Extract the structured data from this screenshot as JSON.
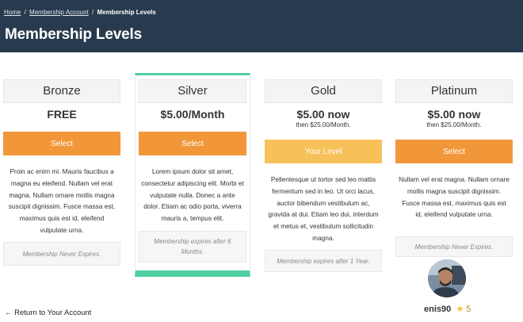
{
  "breadcrumb": {
    "home": "Home",
    "account": "Membership Account",
    "current": "Membership Levels",
    "separator": "/"
  },
  "page_title": "Membership Levels",
  "plans": [
    {
      "name": "Bronze",
      "price": "FREE",
      "price_sub": "",
      "button": "Select",
      "description": "Proin ac enim mi. Mauris faucibus a magna eu eleifend. Nullam vel erat magna. Nullam ornare mollis magna suscipit dignissim. Fusce massa est, maximus quis est id, eleifend vulputate urna.",
      "expiry": "Membership Never Expires."
    },
    {
      "name": "Silver",
      "price": "$5.00/Month",
      "price_sub": "",
      "button": "Select",
      "description": "Lorem ipsum dolor sit amet, consectetur adipiscing elit. Morbi et vulputate nulla. Donec a ante dolor. Etiam ac odio porta, viverra mauris a, tempus elit.",
      "expiry": "Membership expires after 6 Months."
    },
    {
      "name": "Gold",
      "price": "$5.00 now",
      "price_sub": "then $25.00/Month.",
      "button": "Your Level",
      "description": "Pellentesque ut tortor sed leo mattis fermentum sed in leo. Ut orci lacus, auctor bibendum vestibulum ac, gravida at dui. Etiam leo dui, interdum et metus et, vestibulum sollicitudin magna.",
      "expiry": "Membership expires after 1 Year."
    },
    {
      "name": "Platinum",
      "price": "$5.00 now",
      "price_sub": "then $25.00/Month.",
      "button": "Select",
      "description": "Nullam vel erat magna. Nullam ornare mollis magna suscipit dignissim. Fusce massa est, maximus quis est id, eleifend vulputate urna.",
      "expiry": "Membership Never Expires."
    }
  ],
  "return_link": "← Return to Your Account",
  "user": {
    "username": "enis90",
    "star": "★",
    "rating": "5"
  },
  "colors": {
    "header_bg": "#283a4e",
    "button": "#f1973a",
    "current_button": "#f7c15a",
    "highlight": "#4fcf9f"
  }
}
